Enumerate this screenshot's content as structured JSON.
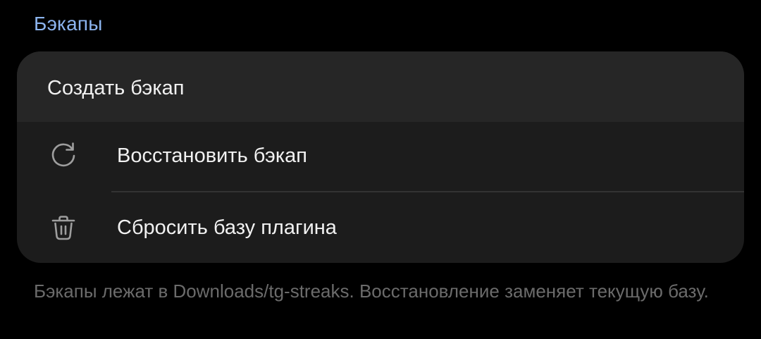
{
  "section": {
    "title": "Бэкапы"
  },
  "menu": {
    "items": [
      {
        "label": "Создать бэкап",
        "icon": ""
      },
      {
        "label": "Восстановить бэкап",
        "icon": "refresh-icon"
      },
      {
        "label": "Сбросить базу плагина",
        "icon": "trash-icon"
      }
    ]
  },
  "footer": {
    "note": "Бэкапы лежат в Downloads/tg-streaks. Восстановление заменяет текущую базу."
  },
  "colors": {
    "background": "#000000",
    "card": "#1c1c1c",
    "highlight_row": "#262626",
    "accent": "#8cb4ee",
    "text": "#f1f1f1",
    "muted_text": "#6b6b6b",
    "icon": "#9e9e9e"
  }
}
